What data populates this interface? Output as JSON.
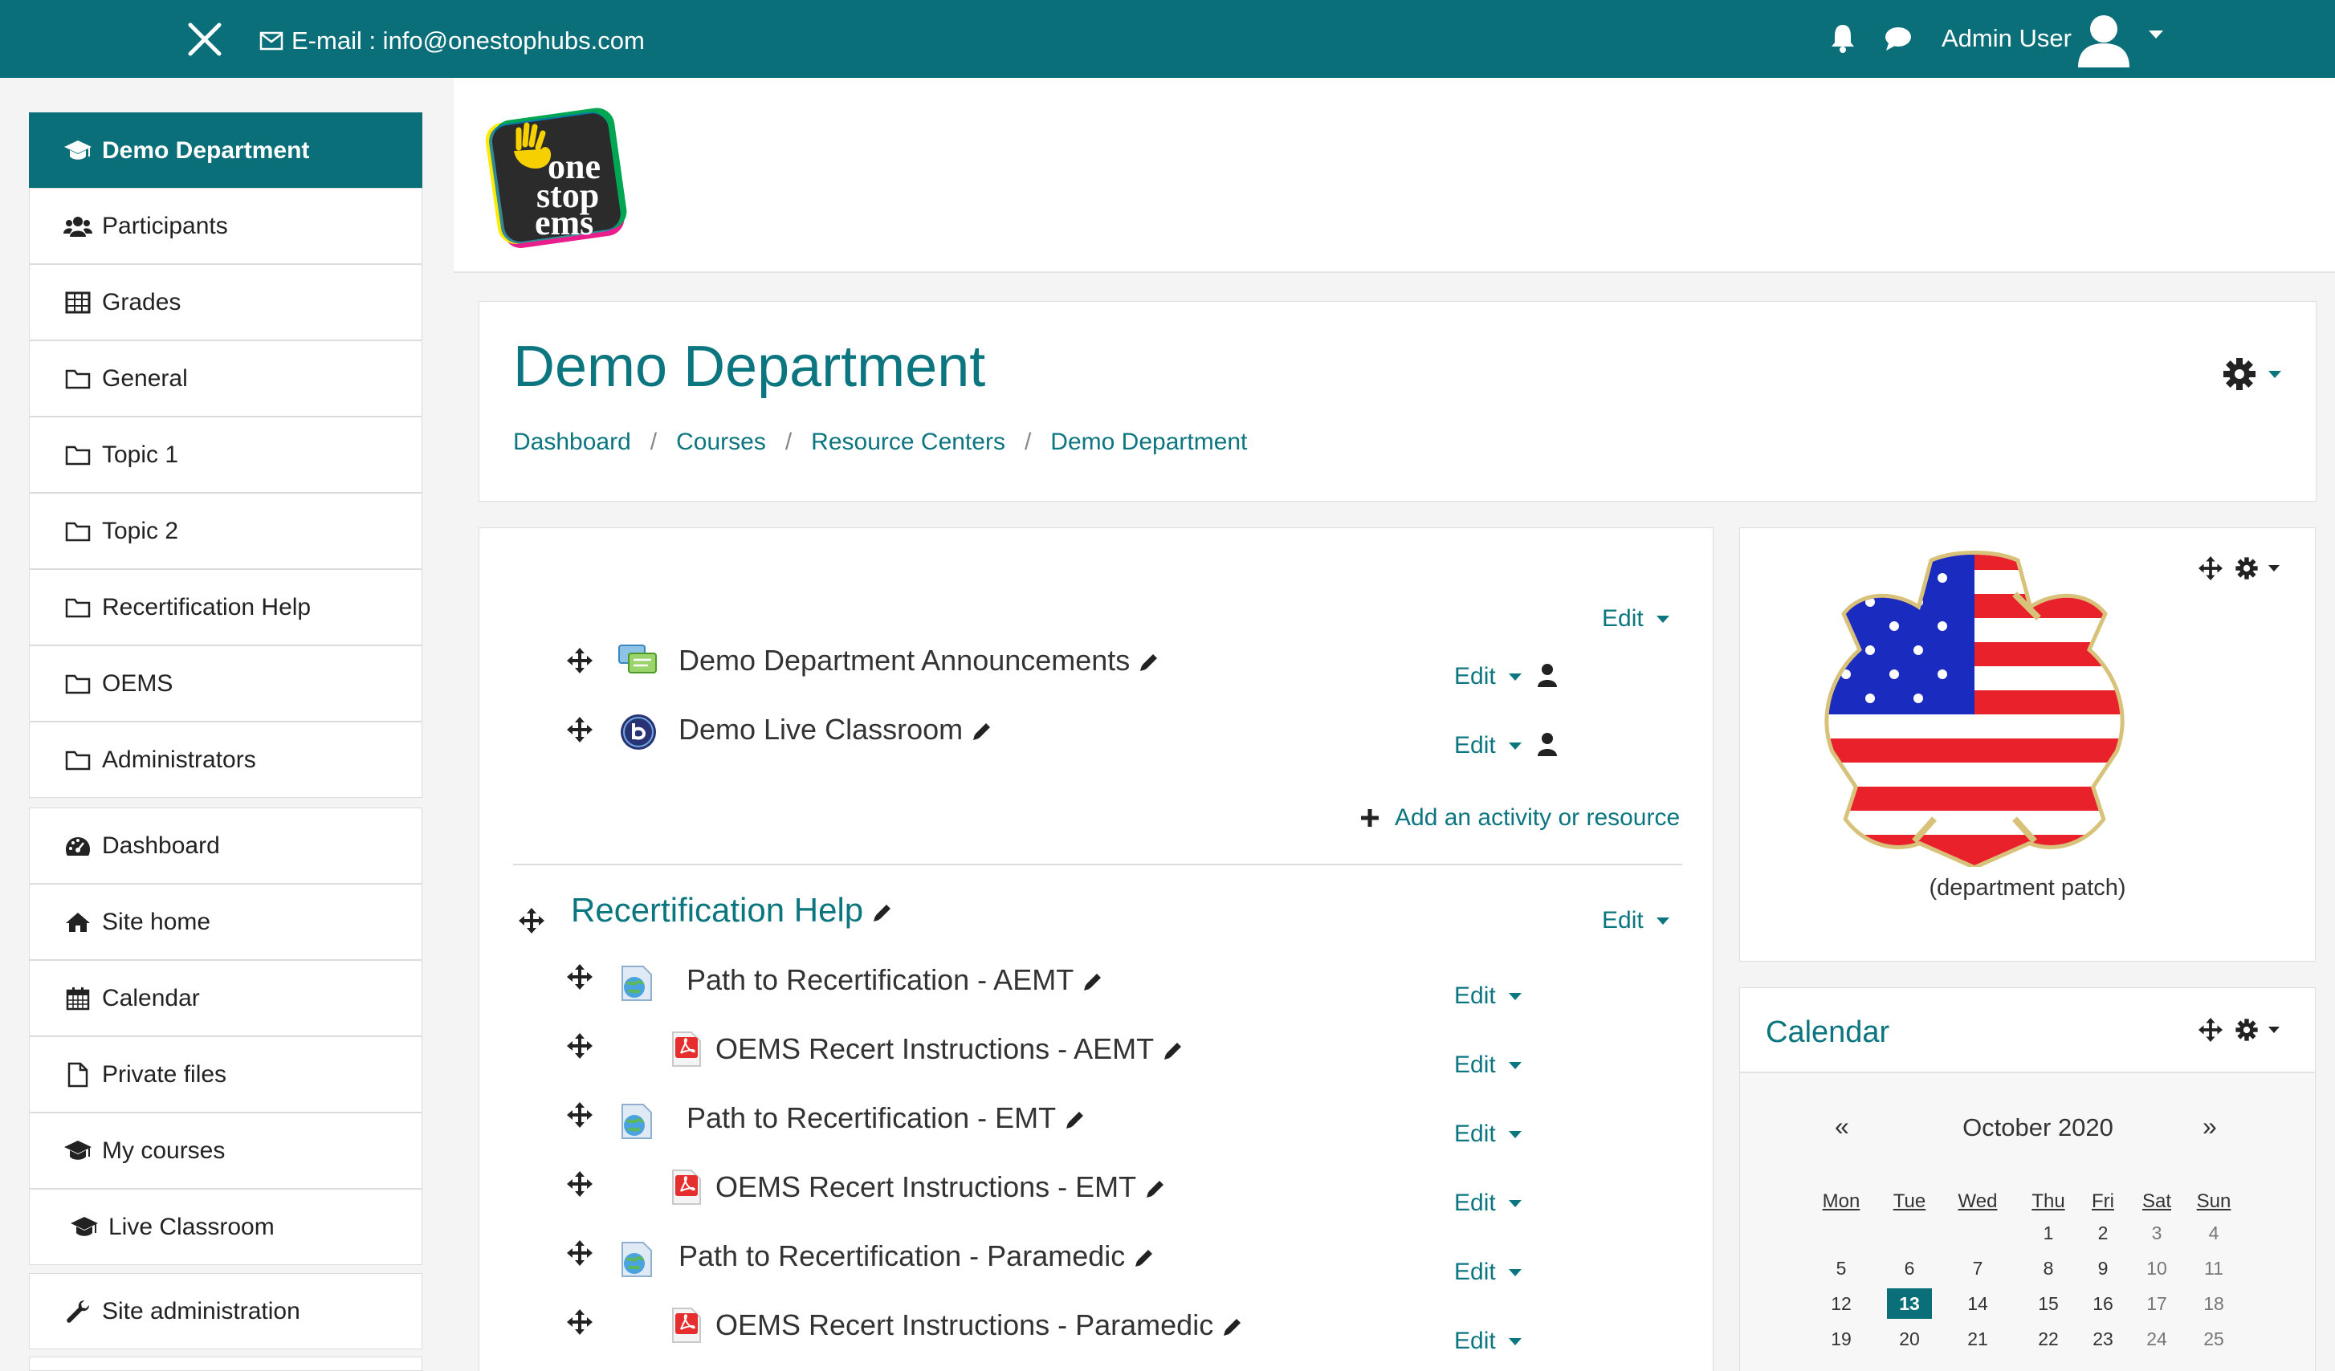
{
  "topbar": {
    "email": "E-mail : info@onestophubs.com",
    "user": "Admin User"
  },
  "sidebar": {
    "items": [
      {
        "label": "Demo Department",
        "icon": "graduation-cap-icon"
      },
      {
        "label": "Participants",
        "icon": "users-icon"
      },
      {
        "label": "Grades",
        "icon": "table-icon"
      },
      {
        "label": "General",
        "icon": "folder-icon"
      },
      {
        "label": "Topic 1",
        "icon": "folder-icon"
      },
      {
        "label": "Topic 2",
        "icon": "folder-icon"
      },
      {
        "label": "Recertification Help",
        "icon": "folder-icon"
      },
      {
        "label": "OEMS",
        "icon": "folder-icon"
      },
      {
        "label": "Administrators",
        "icon": "folder-icon"
      },
      {
        "label": "Dashboard",
        "icon": "dashboard-icon"
      },
      {
        "label": "Site home",
        "icon": "home-icon"
      },
      {
        "label": "Calendar",
        "icon": "calendar-icon"
      },
      {
        "label": "Private files",
        "icon": "file-icon"
      },
      {
        "label": "My courses",
        "icon": "graduation-cap-icon"
      },
      {
        "label": "Live Classroom",
        "icon": "graduation-cap-icon"
      },
      {
        "label": "Site administration",
        "icon": "wrench-icon"
      }
    ]
  },
  "logo": {
    "lines": [
      "one",
      "stop",
      "ems"
    ]
  },
  "header": {
    "title": "Demo Department",
    "breadcrumb": [
      "Dashboard",
      "Courses",
      "Resource Centers",
      "Demo Department"
    ],
    "separator": "/"
  },
  "course": {
    "edit_label": "Edit",
    "general_activities": [
      {
        "name": "Demo Department Announcements",
        "icon": "forum-icon"
      },
      {
        "name": "Demo Live Classroom",
        "icon": "bigbluebutton-icon"
      }
    ],
    "add_activity": "Add an activity or resource",
    "section_title": "Recertification Help",
    "section_activities": [
      {
        "name": "Path to Recertification - AEMT",
        "icon": "url-icon"
      },
      {
        "name": "OEMS Recert Instructions - AEMT",
        "icon": "pdf-icon"
      },
      {
        "name": "Path to Recertification - EMT",
        "icon": "url-icon"
      },
      {
        "name": "OEMS Recert Instructions - EMT",
        "icon": "pdf-icon"
      },
      {
        "name": "Path to Recertification - Paramedic",
        "icon": "url-icon"
      },
      {
        "name": "OEMS Recert Instructions - Paramedic",
        "icon": "pdf-icon"
      }
    ]
  },
  "patch_block": {
    "caption": "(department patch)"
  },
  "calendar": {
    "title": "Calendar",
    "prev": "«",
    "next": "»",
    "month": "October 2020",
    "weekdays": [
      "Mon",
      "Tue",
      "Wed",
      "Thu",
      "Fri",
      "Sat",
      "Sun"
    ],
    "weeks": [
      [
        "",
        "",
        "",
        "1",
        "2",
        "3",
        "4"
      ],
      [
        "5",
        "6",
        "7",
        "8",
        "9",
        "10",
        "11"
      ],
      [
        "12",
        "13",
        "14",
        "15",
        "16",
        "17",
        "18"
      ],
      [
        "19",
        "20",
        "21",
        "22",
        "23",
        "24",
        "25"
      ]
    ],
    "today": "13"
  },
  "colors": {
    "brand": "#0b6f7a",
    "link": "#0b7580",
    "today": "#0b6f7a"
  }
}
